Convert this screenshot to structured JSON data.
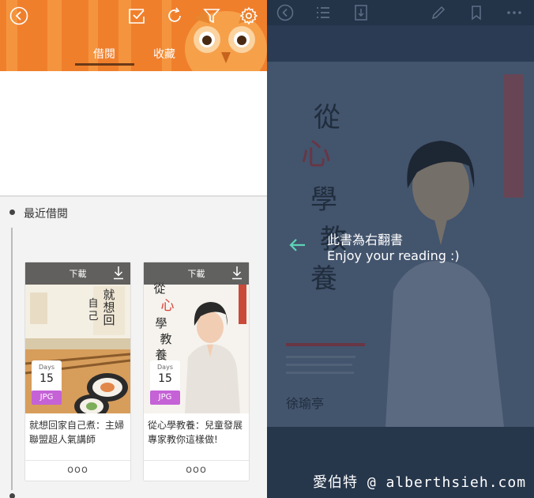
{
  "left": {
    "header": {
      "tabs": [
        {
          "label": "借閱",
          "active": true
        },
        {
          "label": "收藏",
          "active": false
        }
      ],
      "icons": [
        "back-icon",
        "select-icon",
        "refresh-icon",
        "filter-icon",
        "settings-icon"
      ]
    },
    "recent": {
      "title": "最近借閱",
      "books": [
        {
          "download_label": "下載",
          "days_label": "Days",
          "days_value": "15",
          "format": "JPG",
          "title": "就想回家自己煮：主婦聯盟超人氣講師",
          "menu": "ooo"
        },
        {
          "download_label": "下載",
          "days_label": "Days",
          "days_value": "15",
          "format": "JPG",
          "title": "從心學教養：兒童發展專家教你這樣做!",
          "menu": "ooo"
        }
      ]
    }
  },
  "right": {
    "notice_zh": "此書為右翻書",
    "notice_en": "Enjoy your reading :)",
    "toolbar_icons": [
      "back-icon",
      "toc-icon",
      "page-icon",
      "pencil-icon",
      "bookmark-icon",
      "more-icon"
    ]
  },
  "watermark": "愛伯特 @ alberthsieh.com",
  "colors": {
    "header_orange": "#f07f2c",
    "tab_underline": "#6a3a17",
    "jpg_badge": "#c562d6",
    "reader_bg": "#2c3e54",
    "arrow_accent": "#5fd3b5"
  }
}
